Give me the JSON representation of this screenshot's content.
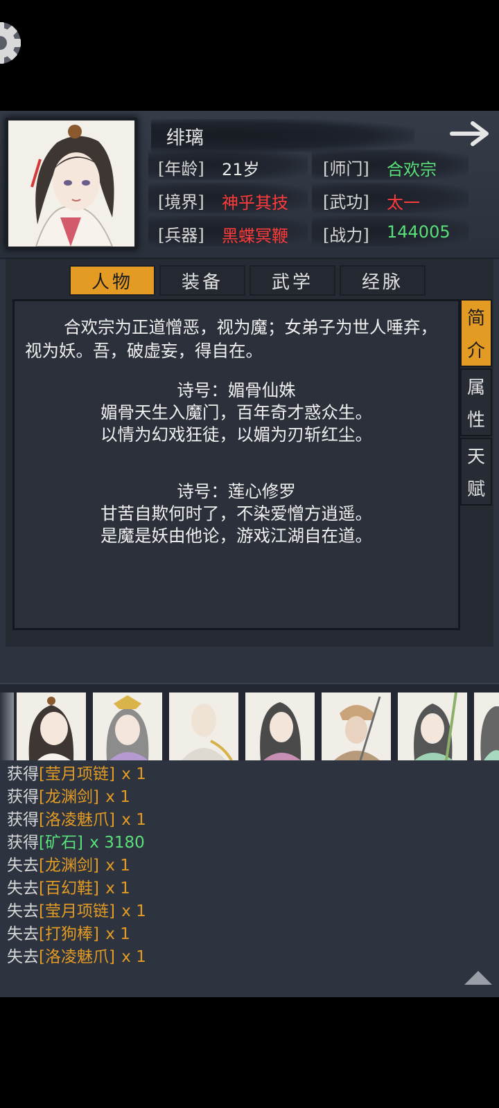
{
  "character": {
    "name": "绯璃",
    "stats": [
      {
        "label": "[年龄]",
        "value": "21岁",
        "color": "white"
      },
      {
        "label": "[师门]",
        "value": "合欢宗",
        "color": "green"
      },
      {
        "label": "[境界]",
        "value": "神乎其技",
        "color": "red"
      },
      {
        "label": "[武功]",
        "value": "太一",
        "color": "red"
      },
      {
        "label": "[兵器]",
        "value": "黑蝶冥鞭",
        "color": "red"
      },
      {
        "label": "[战力]",
        "value": "144005",
        "color": "green"
      }
    ]
  },
  "tabs": [
    {
      "label": "人物",
      "active": true
    },
    {
      "label": "装备",
      "active": false
    },
    {
      "label": "武学",
      "active": false
    },
    {
      "label": "经脉",
      "active": false
    }
  ],
  "side_tabs": [
    {
      "chars": [
        "简",
        "介"
      ],
      "active": true
    },
    {
      "chars": [
        "属",
        "性"
      ],
      "active": false
    },
    {
      "chars": [
        "天",
        "赋"
      ],
      "active": false
    }
  ],
  "intro": {
    "paragraph": "合欢宗为正道憎恶，视为魔；女弟子为世人唾弃，视为妖。吾，破虚妄，得自在。",
    "poems": [
      {
        "title": "诗号：媚骨仙姝",
        "lines": [
          "媚骨天生入魔门，百年奇才惑众生。",
          "以情为幻戏狂徒，以媚为刃斩红尘。"
        ]
      },
      {
        "title": "诗号：莲心修罗",
        "lines": [
          "甘苦自欺何时了，不染爱憎方逍遥。",
          "是魔是妖由他论，游戏江湖自在道。"
        ]
      }
    ]
  },
  "log": [
    {
      "verb": "获得",
      "item": "[莹月项链]",
      "qty": "x 1",
      "color": "orange"
    },
    {
      "verb": "获得",
      "item": "[龙渊剑]",
      "qty": "x 1",
      "color": "orange"
    },
    {
      "verb": "获得",
      "item": "[洛凌魅爪]",
      "qty": "x 1",
      "color": "orange"
    },
    {
      "verb": "获得",
      "item": "[矿石]",
      "qty": "x 3180",
      "color": "green"
    },
    {
      "verb": "失去",
      "item": "[龙渊剑]",
      "qty": "x 1",
      "color": "orange"
    },
    {
      "verb": "失去",
      "item": "[百幻鞋]",
      "qty": "x 1",
      "color": "orange"
    },
    {
      "verb": "失去",
      "item": "[莹月项链]",
      "qty": "x 1",
      "color": "orange"
    },
    {
      "verb": "失去",
      "item": "[打狗棒]",
      "qty": "x 1",
      "color": "orange"
    },
    {
      "verb": "失去",
      "item": "[洛凌魅爪]",
      "qty": "x 1",
      "color": "orange"
    }
  ],
  "colors": {
    "accent": "#e49b23",
    "green": "#59e07a",
    "red": "#ff3b3b",
    "panel": "#2d3440"
  },
  "icons": [
    "gear-icon",
    "arrow-right-icon",
    "scroll-top-icon"
  ]
}
